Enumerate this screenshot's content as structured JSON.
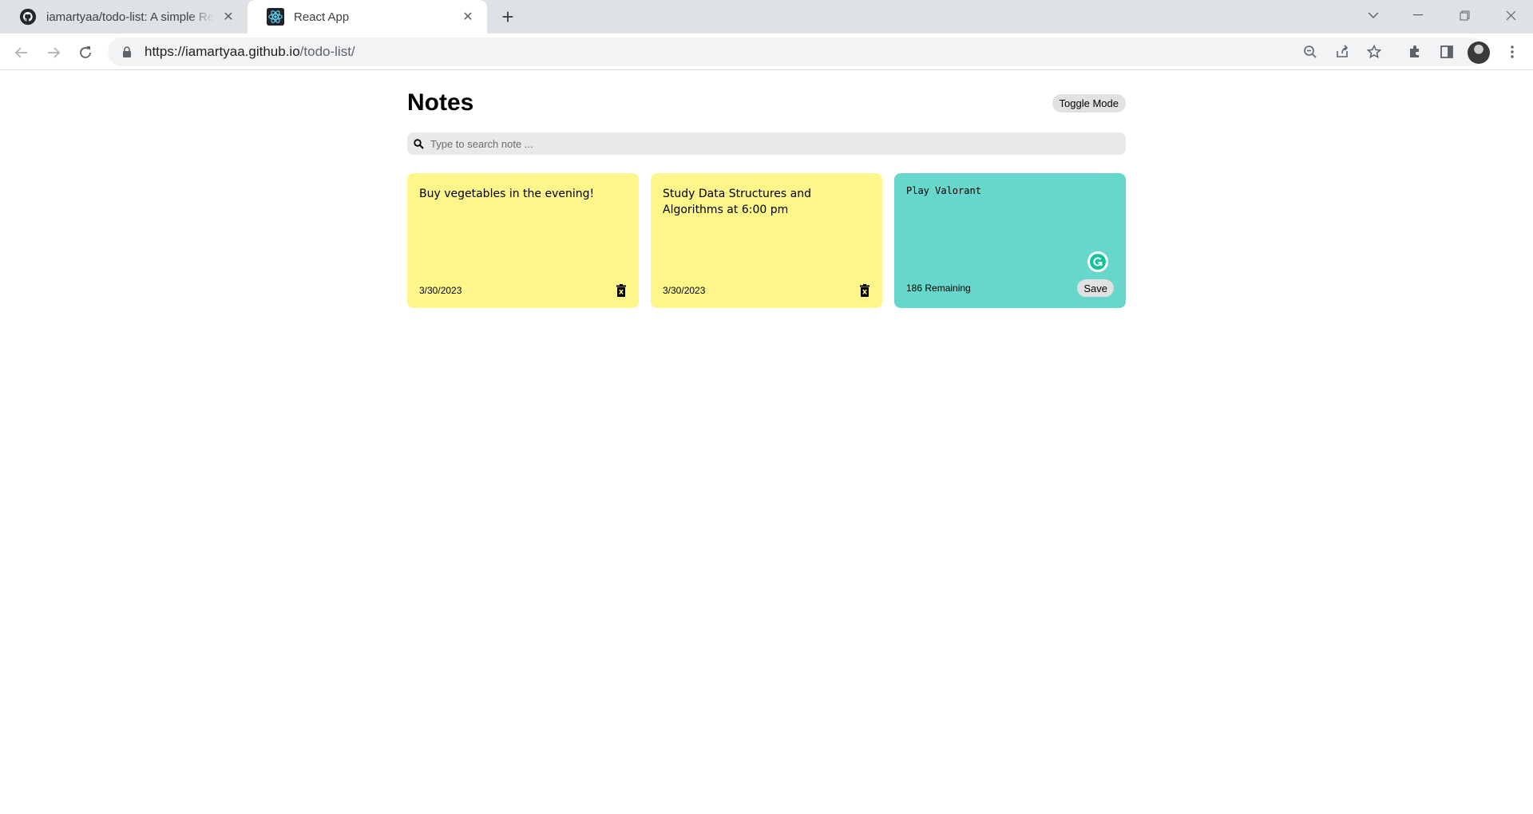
{
  "browser": {
    "tabs": [
      {
        "title": "iamartyaa/todo-list: A simple React Notes App",
        "icon": "github-icon",
        "active": false
      },
      {
        "title": "React App",
        "icon": "react-icon",
        "active": true
      }
    ],
    "url_host": "https://iamartyaa.github.io",
    "url_path": "/todo-list/"
  },
  "app": {
    "title": "Notes",
    "toggle_label": "Toggle Mode",
    "search": {
      "placeholder": "Type to search note ..."
    }
  },
  "notes": [
    {
      "text": "Buy vegetables in the evening!",
      "date": "3/30/2023",
      "color": "#fef68a"
    },
    {
      "text": "Study Data Structures and Algorithms at 6:00 pm",
      "date": "3/30/2023",
      "color": "#fef68a"
    }
  ],
  "new_note": {
    "text": "Play Valorant",
    "remaining": "186 Remaining",
    "save_label": "Save",
    "color": "#67d7cc"
  },
  "colors": {
    "yellow_note": "#fef68a",
    "teal_note": "#67d7cc",
    "grammarly": "#15c39a"
  }
}
